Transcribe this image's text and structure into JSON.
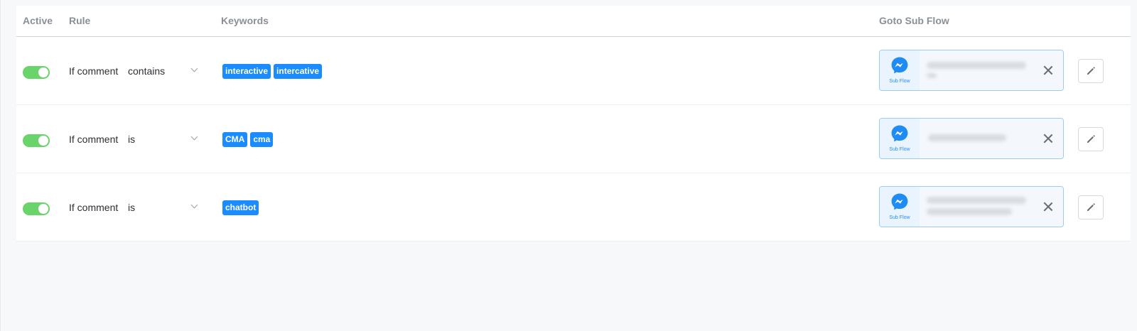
{
  "headers": {
    "active": "Active",
    "rule": "Rule",
    "keywords": "Keywords",
    "goto": "Goto Sub Flow"
  },
  "rows": [
    {
      "active": true,
      "rule_label": "If comment",
      "condition": "contains",
      "keywords": [
        "interactive",
        "intercative"
      ],
      "subflow_label": "Sub Flow"
    },
    {
      "active": true,
      "rule_label": "If comment",
      "condition": "is",
      "keywords": [
        "CMA",
        "cma"
      ],
      "subflow_label": "Sub Flow"
    },
    {
      "active": true,
      "rule_label": "If comment",
      "condition": "is",
      "keywords": [
        "chatbot"
      ],
      "subflow_label": "Sub Flow"
    }
  ],
  "colors": {
    "toggle_on": "#69d46a",
    "keyword_chip": "#1a8cff",
    "subflow_border": "#9ccaf2",
    "messenger_blue": "#1e8cf2"
  },
  "icons": {
    "subflow": "messenger-icon",
    "remove": "close-icon",
    "edit": "pencil-icon",
    "dropdown": "chevron-down-icon"
  }
}
